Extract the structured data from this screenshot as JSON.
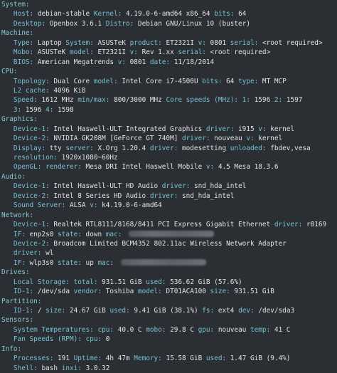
{
  "sections": [
    {
      "title": "System:",
      "lines": [
        [
          [
            "k",
            "   Host: "
          ],
          [
            "v",
            "debian-stable "
          ],
          [
            "k",
            "Kernel: "
          ],
          [
            "v",
            "4.19.0-6-amd64 x86_64 "
          ],
          [
            "k",
            "bits: "
          ],
          [
            "v",
            "64"
          ]
        ],
        [
          [
            "k",
            "   Desktop: "
          ],
          [
            "v",
            "Openbox 3.6.1 "
          ],
          [
            "k",
            "Distro: "
          ],
          [
            "v",
            "Debian GNU/Linux 10 (buster)"
          ]
        ]
      ]
    },
    {
      "title": "Machine:",
      "lines": [
        [
          [
            "k",
            "   Type: "
          ],
          [
            "v",
            "Laptop "
          ],
          [
            "k",
            "System: "
          ],
          [
            "v",
            "ASUSTeK "
          ],
          [
            "k",
            "product: "
          ],
          [
            "v",
            "ET2321I "
          ],
          [
            "k",
            "v: "
          ],
          [
            "v",
            "0801 "
          ],
          [
            "k",
            "serial: "
          ],
          [
            "v",
            "<root required>"
          ]
        ],
        [
          [
            "k",
            "   Mobo: "
          ],
          [
            "v",
            "ASUSTeK "
          ],
          [
            "k",
            "model: "
          ],
          [
            "v",
            "ET2321I "
          ],
          [
            "k",
            "v: "
          ],
          [
            "v",
            "Rev 1.xx "
          ],
          [
            "k",
            "serial: "
          ],
          [
            "v",
            "<root required>"
          ]
        ],
        [
          [
            "k",
            "   BIOS: "
          ],
          [
            "v",
            "American Megatrends "
          ],
          [
            "k",
            "v: "
          ],
          [
            "v",
            "0801 "
          ],
          [
            "k",
            "date: "
          ],
          [
            "v",
            "11/18/2014"
          ]
        ]
      ]
    },
    {
      "title": "CPU:",
      "lines": [
        [
          [
            "k",
            "   Topology: "
          ],
          [
            "v",
            "Dual Core "
          ],
          [
            "k",
            "model: "
          ],
          [
            "v",
            "Intel Core i7-4500U "
          ],
          [
            "k",
            "bits: "
          ],
          [
            "v",
            "64 "
          ],
          [
            "k",
            "type: "
          ],
          [
            "v",
            "MT MCP"
          ]
        ],
        [
          [
            "k",
            "   L2 cache: "
          ],
          [
            "v",
            "4096 KiB"
          ]
        ],
        [
          [
            "k",
            "   Speed: "
          ],
          [
            "v",
            "1612 MHz "
          ],
          [
            "k",
            "min/max: "
          ],
          [
            "v",
            "800/3000 MHz "
          ],
          [
            "k",
            "Core speeds (MHz): "
          ],
          [
            "k",
            "1: "
          ],
          [
            "v",
            "1596 "
          ],
          [
            "k",
            "2: "
          ],
          [
            "v",
            "1597"
          ]
        ],
        [
          [
            "k",
            "   3: "
          ],
          [
            "v",
            "1596 "
          ],
          [
            "k",
            "4: "
          ],
          [
            "v",
            "1598"
          ]
        ]
      ]
    },
    {
      "title": "Graphics:",
      "lines": [
        [
          [
            "k",
            "   Device-1: "
          ],
          [
            "v",
            "Intel Haswell-ULT Integrated Graphics "
          ],
          [
            "k",
            "driver: "
          ],
          [
            "v",
            "i915 "
          ],
          [
            "k",
            "v: "
          ],
          [
            "v",
            "kernel"
          ]
        ],
        [
          [
            "k",
            "   Device-2: "
          ],
          [
            "v",
            "NVIDIA GK208M [GeForce GT 740M] "
          ],
          [
            "k",
            "driver: "
          ],
          [
            "v",
            "nouveau "
          ],
          [
            "k",
            "v: "
          ],
          [
            "v",
            "kernel"
          ]
        ],
        [
          [
            "k",
            "   Display: "
          ],
          [
            "v",
            "tty "
          ],
          [
            "k",
            "server: "
          ],
          [
            "v",
            "X.Org 1.20.4 "
          ],
          [
            "k",
            "driver: "
          ],
          [
            "v",
            "modesetting "
          ],
          [
            "k",
            "unloaded: "
          ],
          [
            "v",
            "fbdev,vesa"
          ]
        ],
        [
          [
            "k",
            "   resolution: "
          ],
          [
            "v",
            "1920x1080~60Hz"
          ]
        ],
        [
          [
            "k",
            "   OpenGL: "
          ],
          [
            "k",
            "renderer: "
          ],
          [
            "v",
            "Mesa DRI Intel Haswell Mobile "
          ],
          [
            "k",
            "v: "
          ],
          [
            "v",
            "4.5 Mesa 18.3.6"
          ]
        ]
      ]
    },
    {
      "title": "Audio:",
      "lines": [
        [
          [
            "k",
            "   Device-1: "
          ],
          [
            "v",
            "Intel Haswell-ULT HD Audio "
          ],
          [
            "k",
            "driver: "
          ],
          [
            "v",
            "snd_hda_intel"
          ]
        ],
        [
          [
            "k",
            "   Device-2: "
          ],
          [
            "v",
            "Intel 8 Series HD Audio "
          ],
          [
            "k",
            "driver: "
          ],
          [
            "v",
            "snd_hda_intel"
          ]
        ],
        [
          [
            "k",
            "   Sound Server: "
          ],
          [
            "v",
            "ALSA "
          ],
          [
            "k",
            "v: "
          ],
          [
            "v",
            "k4.19.0-6-amd64"
          ]
        ]
      ]
    },
    {
      "title": "Network:",
      "lines": [
        [
          [
            "k",
            "   Device-1: "
          ],
          [
            "v",
            "Realtek RTL8111/8168/8411 PCI Express Gigabit Ethernet "
          ],
          [
            "k",
            "driver: "
          ],
          [
            "v",
            "r8169"
          ]
        ],
        [
          [
            "k",
            "   IF: "
          ],
          [
            "v",
            "enp2s0 "
          ],
          [
            "k",
            "state: "
          ],
          [
            "v",
            "down "
          ],
          [
            "k",
            "mac: "
          ],
          [
            "blur",
            "mid"
          ]
        ],
        [
          [
            "k",
            "   Device-2: "
          ],
          [
            "v",
            "Broadcom Limited BCM4352 802.11ac Wireless Network Adapter"
          ]
        ],
        [
          [
            "k",
            "   driver: "
          ],
          [
            "v",
            "wl"
          ]
        ],
        [
          [
            "k",
            "   IF: "
          ],
          [
            "v",
            "wlp3s0 "
          ],
          [
            "k",
            "state: "
          ],
          [
            "v",
            "up "
          ],
          [
            "k",
            "mac: "
          ],
          [
            "blur",
            "mid"
          ]
        ]
      ]
    },
    {
      "title": "Drives:",
      "lines": [
        [
          [
            "k",
            "   Local Storage: "
          ],
          [
            "k",
            "total: "
          ],
          [
            "v",
            "931.51 GiB "
          ],
          [
            "k",
            "used: "
          ],
          [
            "v",
            "536.62 GiB (57.6%)"
          ]
        ],
        [
          [
            "k",
            "   ID-1: "
          ],
          [
            "v",
            "/dev/sda "
          ],
          [
            "k",
            "vendor: "
          ],
          [
            "v",
            "Toshiba "
          ],
          [
            "k",
            "model: "
          ],
          [
            "v",
            "DT01ACA100 "
          ],
          [
            "k",
            "size: "
          ],
          [
            "v",
            "931.51 GiB"
          ]
        ]
      ]
    },
    {
      "title": "Partition:",
      "lines": [
        [
          [
            "k",
            "   ID-1: "
          ],
          [
            "v",
            "/ "
          ],
          [
            "k",
            "size: "
          ],
          [
            "v",
            "24.67 GiB "
          ],
          [
            "k",
            "used: "
          ],
          [
            "v",
            "9.41 GiB (38.1%) "
          ],
          [
            "k",
            "fs: "
          ],
          [
            "v",
            "ext4 "
          ],
          [
            "k",
            "dev: "
          ],
          [
            "v",
            "/dev/sda3"
          ]
        ]
      ]
    },
    {
      "title": "Sensors:",
      "lines": [
        [
          [
            "k",
            "   System Temperatures: "
          ],
          [
            "k",
            "cpu: "
          ],
          [
            "v",
            "40.0 C "
          ],
          [
            "k",
            "mobo: "
          ],
          [
            "v",
            "29.8 C "
          ],
          [
            "k",
            "gpu: "
          ],
          [
            "v",
            "nouveau "
          ],
          [
            "k",
            "temp: "
          ],
          [
            "v",
            "41 C"
          ]
        ],
        [
          [
            "k",
            "   Fan Speeds (RPM): "
          ],
          [
            "k",
            "cpu: "
          ],
          [
            "v",
            "0"
          ]
        ]
      ]
    },
    {
      "title": "Info:",
      "lines": [
        [
          [
            "k",
            "   Processes: "
          ],
          [
            "v",
            "191 "
          ],
          [
            "k",
            "Uptime: "
          ],
          [
            "v",
            "4h 47m "
          ],
          [
            "k",
            "Memory: "
          ],
          [
            "v",
            "15.58 GiB "
          ],
          [
            "k",
            "used: "
          ],
          [
            "v",
            "1.47 GiB (9.4%)"
          ]
        ],
        [
          [
            "k",
            "   Shell: "
          ],
          [
            "v",
            "bash "
          ],
          [
            "k",
            "inxi: "
          ],
          [
            "v",
            "3.0.32"
          ]
        ]
      ]
    }
  ],
  "colors": {
    "background": "#2b2f33",
    "section": "#86c9d3",
    "key": "#78c0d6",
    "value": "#dfe3e6"
  }
}
